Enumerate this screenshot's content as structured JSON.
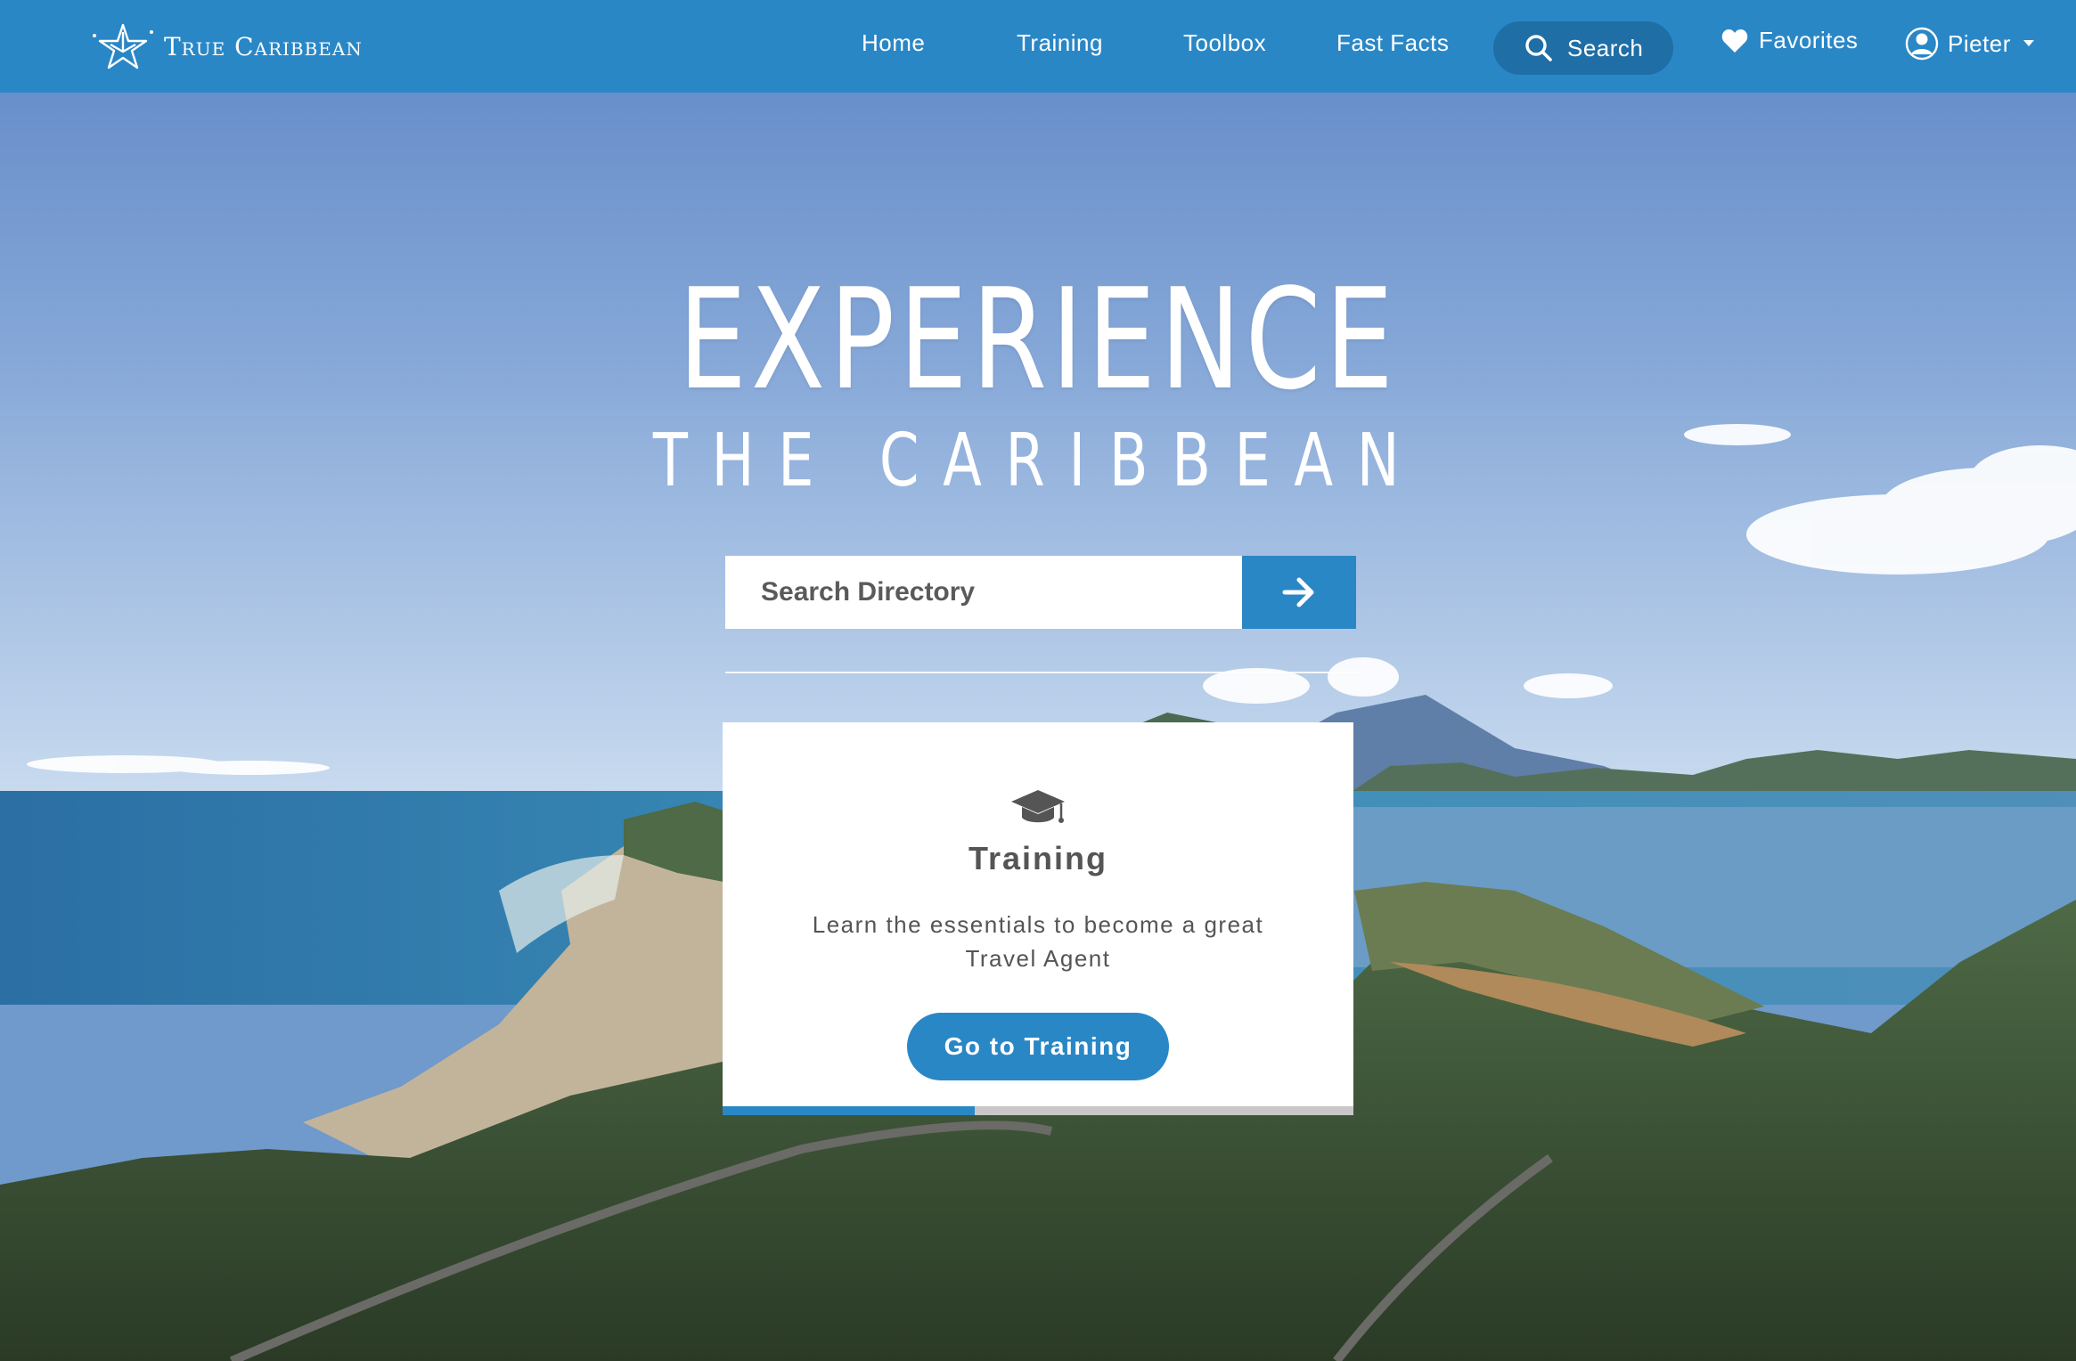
{
  "brand": {
    "name": "True Caribbean",
    "logo": "starfish-logo"
  },
  "nav": {
    "items": [
      {
        "label": "Home"
      },
      {
        "label": "Training"
      },
      {
        "label": "Toolbox"
      },
      {
        "label": "Fast Facts"
      }
    ],
    "search": {
      "label": "Search",
      "icon": "search-icon"
    },
    "favorites": {
      "label": "Favorites",
      "icon": "heart-icon"
    },
    "user": {
      "label": "Pieter",
      "icon": "user-icon"
    },
    "bar_color": "#2a87c6"
  },
  "hero": {
    "headline": "EXPERIENCE",
    "subheadline": "THE CARIBBEAN"
  },
  "search_directory": {
    "placeholder": "Search Directory",
    "submit_icon": "arrow-right-icon"
  },
  "card": {
    "icon": "graduation-cap-icon",
    "title": "Training",
    "description": "Learn the essentials to become a great Travel Agent",
    "button_label": "Go to Training",
    "progress": 0.4
  }
}
